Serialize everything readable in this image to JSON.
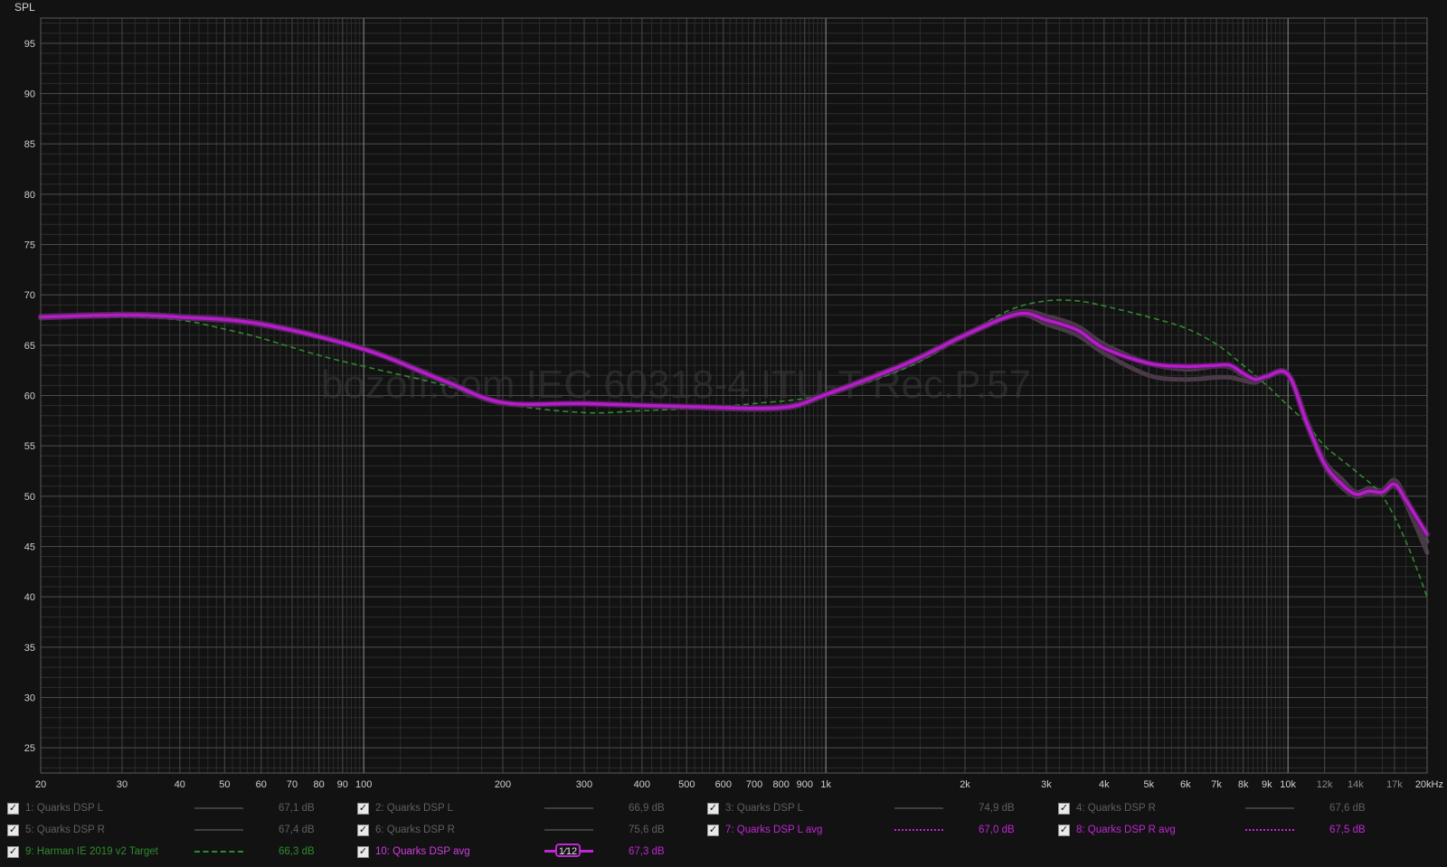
{
  "colors": {
    "background": "#121212",
    "grid_major": "#8c8c8c",
    "grid_minor": "#2c2c2c",
    "measurement_raw": "#4a3a48",
    "avg_curve": "#b71cc9",
    "target_curve": "#2e8b2e",
    "legend_dim": "#5f5f5f",
    "legend_target": "#2e8b2e",
    "legend_active": "#c026d3"
  },
  "watermark": "bozoff.com IEC 60318-4 ITU-T Rec.P.57",
  "chart_data": {
    "type": "line",
    "title": "",
    "xlabel": "",
    "ylabel": "SPL",
    "x_scale": "log",
    "xlim": [
      20,
      20000
    ],
    "ylim": [
      22.5,
      97.5
    ],
    "grid": true,
    "y_ticks": [
      25,
      30,
      35,
      40,
      45,
      50,
      55,
      60,
      65,
      70,
      75,
      80,
      85,
      90,
      95
    ],
    "x_ticks": [
      {
        "v": 20,
        "label": "20"
      },
      {
        "v": 30,
        "label": "30"
      },
      {
        "v": 40,
        "label": "40"
      },
      {
        "v": 50,
        "label": "50"
      },
      {
        "v": 60,
        "label": "60"
      },
      {
        "v": 70,
        "label": "70"
      },
      {
        "v": 80,
        "label": "80"
      },
      {
        "v": 90,
        "label": "90"
      },
      {
        "v": 100,
        "label": "100"
      },
      {
        "v": 200,
        "label": "200"
      },
      {
        "v": 300,
        "label": "300"
      },
      {
        "v": 400,
        "label": "400"
      },
      {
        "v": 500,
        "label": "500"
      },
      {
        "v": 600,
        "label": "600"
      },
      {
        "v": 700,
        "label": "700"
      },
      {
        "v": 800,
        "label": "800"
      },
      {
        "v": 900,
        "label": "900"
      },
      {
        "v": 1000,
        "label": "1k"
      },
      {
        "v": 2000,
        "label": "2k"
      },
      {
        "v": 3000,
        "label": "3k"
      },
      {
        "v": 4000,
        "label": "4k"
      },
      {
        "v": 5000,
        "label": "5k"
      },
      {
        "v": 6000,
        "label": "6k"
      },
      {
        "v": 7000,
        "label": "7k"
      },
      {
        "v": 8000,
        "label": "8k"
      },
      {
        "v": 9000,
        "label": "9k"
      },
      {
        "v": 10000,
        "label": "10k"
      },
      {
        "v": 12000,
        "label": "12k",
        "dim": true
      },
      {
        "v": 14000,
        "label": "14k",
        "dim": true
      },
      {
        "v": 17000,
        "label": "17k",
        "dim": true
      },
      {
        "v": 20000,
        "label": "20kHz"
      }
    ],
    "series": [
      {
        "name": "Quarks DSP L",
        "role": "raw",
        "x": [
          20,
          30,
          40,
          60,
          100,
          150,
          200,
          300,
          500,
          800,
          1000,
          1500,
          2000,
          2600,
          3000,
          3500,
          4000,
          5000,
          6000,
          7000,
          7500,
          8000,
          8500,
          9000,
          10000,
          11000,
          12000,
          13000,
          14000,
          15000,
          16000,
          17000,
          18000,
          20000
        ],
        "y": [
          67.9,
          68.1,
          67.9,
          67.2,
          64.7,
          61.5,
          59.3,
          59.2,
          58.9,
          58.9,
          60.2,
          63.3,
          66.1,
          68.3,
          67.9,
          66.9,
          65.1,
          63.2,
          62.6,
          62.9,
          62.8,
          62.0,
          61.6,
          62.0,
          62.2,
          57.5,
          53.5,
          51.8,
          50.4,
          50.8,
          50.6,
          51.6,
          49.8,
          45.5
        ]
      },
      {
        "name": "Quarks DSP R",
        "role": "raw",
        "x": [
          20,
          30,
          40,
          60,
          100,
          150,
          200,
          300,
          500,
          800,
          1000,
          1500,
          2000,
          2600,
          3000,
          3500,
          4000,
          5000,
          6000,
          7000,
          7500,
          8000,
          8500,
          9000,
          10000,
          11000,
          12000,
          13000,
          14000,
          15000,
          16000,
          17000,
          18000,
          20000
        ],
        "y": [
          67.7,
          67.9,
          67.7,
          67.0,
          64.6,
          61.3,
          59.2,
          59.2,
          58.8,
          58.7,
          60.0,
          63.0,
          65.9,
          68.0,
          67.1,
          66.0,
          64.2,
          62.0,
          61.6,
          61.8,
          61.8,
          61.5,
          61.3,
          61.8,
          62.0,
          57.0,
          53.0,
          51.0,
          50.0,
          50.3,
          50.2,
          51.0,
          49.3,
          44.4
        ]
      },
      {
        "name": "Harman IE 2019 v2 Target",
        "role": "target",
        "x": [
          20,
          30,
          40,
          50,
          60,
          80,
          100,
          150,
          200,
          300,
          400,
          500,
          700,
          1000,
          1500,
          2000,
          2500,
          3000,
          3500,
          4000,
          5000,
          6000,
          7000,
          8000,
          9000,
          10000,
          11000,
          12000,
          14000,
          16000,
          18000,
          20000
        ],
        "y": [
          67.7,
          67.8,
          67.5,
          66.6,
          65.7,
          64.0,
          62.9,
          61.0,
          59.2,
          58.3,
          58.5,
          58.7,
          59.2,
          60.1,
          62.8,
          66.0,
          68.5,
          69.4,
          69.4,
          68.9,
          67.8,
          66.7,
          65.1,
          63.0,
          61.0,
          59.0,
          57.2,
          55.0,
          52.5,
          50.0,
          45.5,
          40.0
        ]
      },
      {
        "name": "Quarks DSP avg",
        "role": "avg",
        "x": [
          20,
          30,
          40,
          60,
          100,
          150,
          200,
          300,
          500,
          800,
          1000,
          1500,
          2000,
          2600,
          3000,
          3500,
          4000,
          5000,
          6000,
          7000,
          7500,
          8000,
          8500,
          9000,
          10000,
          11000,
          12000,
          13000,
          14000,
          15000,
          16000,
          17000,
          18000,
          20000
        ],
        "y": [
          67.8,
          68.0,
          67.8,
          67.1,
          64.6,
          61.4,
          59.3,
          59.2,
          58.9,
          58.8,
          60.1,
          63.2,
          66.0,
          68.1,
          67.5,
          66.5,
          64.7,
          63.2,
          62.9,
          63.0,
          63.0,
          62.2,
          61.6,
          61.9,
          62.1,
          57.2,
          53.2,
          51.3,
          50.2,
          50.5,
          50.4,
          51.2,
          49.6,
          46.2
        ]
      }
    ]
  },
  "legend": {
    "rows": [
      [
        {
          "label": "1: Quarks DSP L",
          "value": "67,1 dB",
          "color_key": "dim",
          "swatch": "solid"
        },
        {
          "label": "2: Quarks DSP L",
          "value": "66,9 dB",
          "color_key": "dim",
          "swatch": "solid"
        },
        {
          "label": "3: Quarks DSP L",
          "value": "74,9 dB",
          "color_key": "dim",
          "swatch": "solid"
        },
        {
          "label": "4: Quarks DSP R",
          "value": "67,6 dB",
          "color_key": "dim",
          "swatch": "solid"
        }
      ],
      [
        {
          "label": "5: Quarks DSP R",
          "value": "67,4 dB",
          "color_key": "dim",
          "swatch": "solid"
        },
        {
          "label": "6: Quarks DSP R",
          "value": "75,6 dB",
          "color_key": "dim",
          "swatch": "solid"
        },
        {
          "label": "7: Quarks DSP L avg",
          "value": "67,0 dB",
          "color_key": "active",
          "swatch": "dotted"
        },
        {
          "label": "8: Quarks DSP R avg",
          "value": "67,5 dB",
          "color_key": "active",
          "swatch": "dotted"
        }
      ],
      [
        {
          "label": "9: Harman IE 2019 v2 Target",
          "value": "66,3 dB",
          "color_key": "target",
          "swatch": "dashed"
        },
        {
          "label": "10: Quarks DSP avg",
          "value": "67,3 dB",
          "color_key": "active",
          "swatch": "smoothing",
          "badge": "1⁄12"
        }
      ]
    ]
  }
}
